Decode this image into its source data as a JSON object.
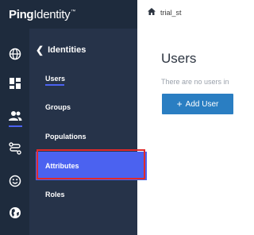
{
  "brand": {
    "logo_bold": "Ping",
    "logo_regular": "Identity",
    "trademark": "™"
  },
  "rail": {
    "icons": [
      {
        "name": "globe-icon"
      },
      {
        "name": "dashboard-icon"
      },
      {
        "name": "users-icon",
        "active": true
      },
      {
        "name": "connections-icon"
      },
      {
        "name": "smiley-icon"
      },
      {
        "name": "earth-icon"
      }
    ]
  },
  "panel": {
    "header": "Identities",
    "items": [
      {
        "label": "Users"
      },
      {
        "label": "Groups"
      },
      {
        "label": "Populations"
      },
      {
        "label": "Attributes"
      },
      {
        "label": "Roles"
      }
    ]
  },
  "breadcrumb": {
    "environment": "trial_st"
  },
  "main": {
    "title": "Users",
    "empty_text": "There are no users in",
    "add_button": "Add User"
  },
  "colors": {
    "rail_bg": "#1e2b3d",
    "panel_bg": "#263349",
    "accent": "#4b62f0",
    "button_blue": "#2a7ec2",
    "highlight_red": "#e12a2a"
  }
}
